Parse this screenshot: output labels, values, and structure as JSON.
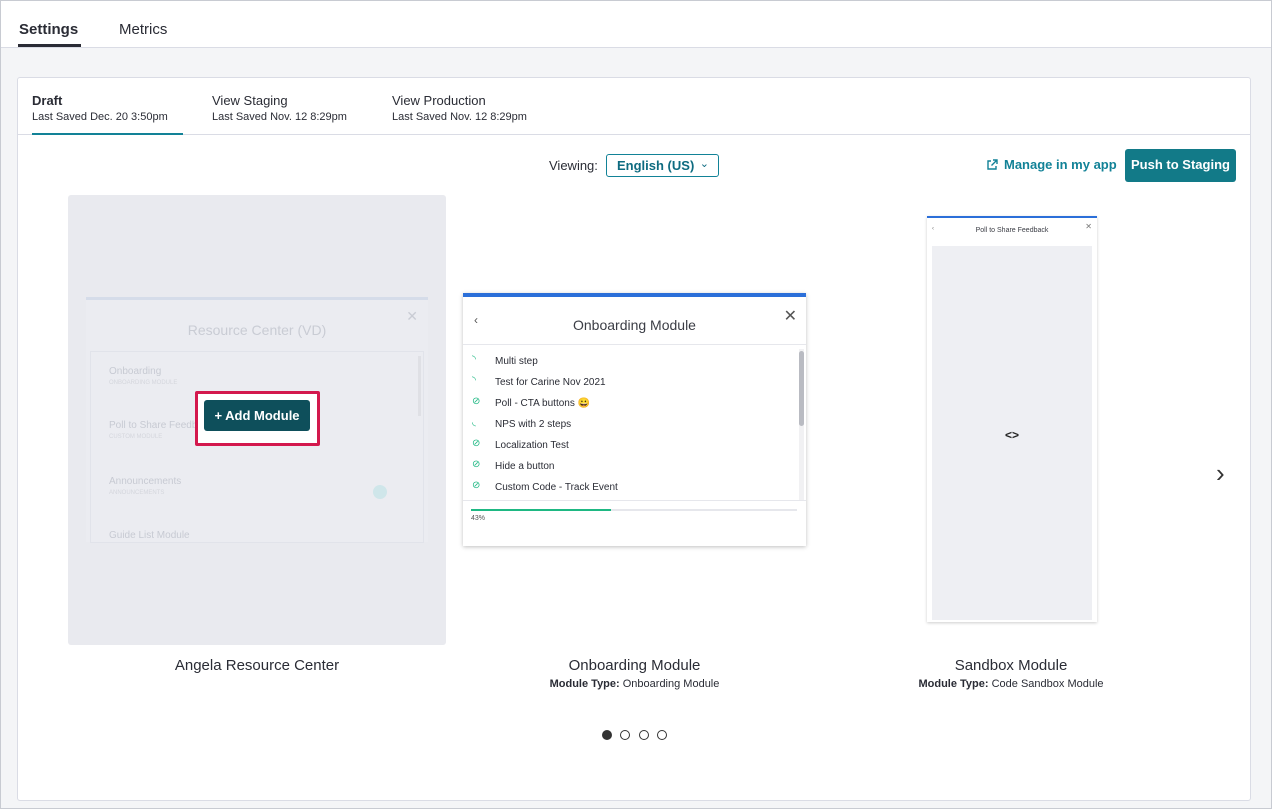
{
  "top_tabs": [
    {
      "label": "Settings",
      "active": true
    },
    {
      "label": "Metrics",
      "active": false
    }
  ],
  "version_tabs": [
    {
      "title": "Draft",
      "saved": "Last Saved Dec. 20 3:50pm",
      "active": true
    },
    {
      "title": "View Staging",
      "saved": "Last Saved Nov. 12 8:29pm",
      "active": false
    },
    {
      "title": "View Production",
      "saved": "Last Saved Nov. 12 8:29pm",
      "active": false
    }
  ],
  "toolbar": {
    "viewing_label": "Viewing:",
    "language_value": "English (US)",
    "manage_label": "Manage in my app",
    "push_label": "Push to Staging"
  },
  "cards": {
    "resource_center": {
      "name": "Angela Resource Center",
      "preview_title": "Resource Center (VD)",
      "items": [
        {
          "label": "Onboarding",
          "sub": "ONBOARDING MODULE"
        },
        {
          "label": "Poll to Share Feedback",
          "sub": "CUSTOM MODULE"
        },
        {
          "label": "Announcements",
          "sub": "ANNOUNCEMENTS"
        },
        {
          "label": "Guide List Module",
          "sub": ""
        }
      ],
      "add_button": "+ Add Module"
    },
    "onboarding": {
      "name": "Onboarding Module",
      "type_label": "Module Type:",
      "type_value": "Onboarding Module",
      "preview_title": "Onboarding Module",
      "items": [
        {
          "label": "Multi step",
          "status": "in-progress"
        },
        {
          "label": "Test for Carine Nov 2021",
          "status": "in-progress"
        },
        {
          "label": "Poll - CTA buttons 😀",
          "status": "complete"
        },
        {
          "label": "NPS with 2 steps",
          "status": "partial"
        },
        {
          "label": "Localization Test",
          "status": "complete"
        },
        {
          "label": "Hide a button",
          "status": "complete"
        },
        {
          "label": "Custom Code - Track Event",
          "status": "complete"
        }
      ],
      "progress": 0.43,
      "progress_label": "43%"
    },
    "sandbox": {
      "name": "Sandbox Module",
      "type_label": "Module Type:",
      "type_value": "Code Sandbox Module",
      "preview_title": "Poll to Share Feedback",
      "code_icon": "<>"
    }
  },
  "pagination": {
    "count": 4,
    "active": 0
  },
  "colors": {
    "accent": "#128297",
    "push_button": "#127a88",
    "highlight": "#d3184d",
    "progress": "#1eb883",
    "preview_top": "#2b6fd9"
  }
}
